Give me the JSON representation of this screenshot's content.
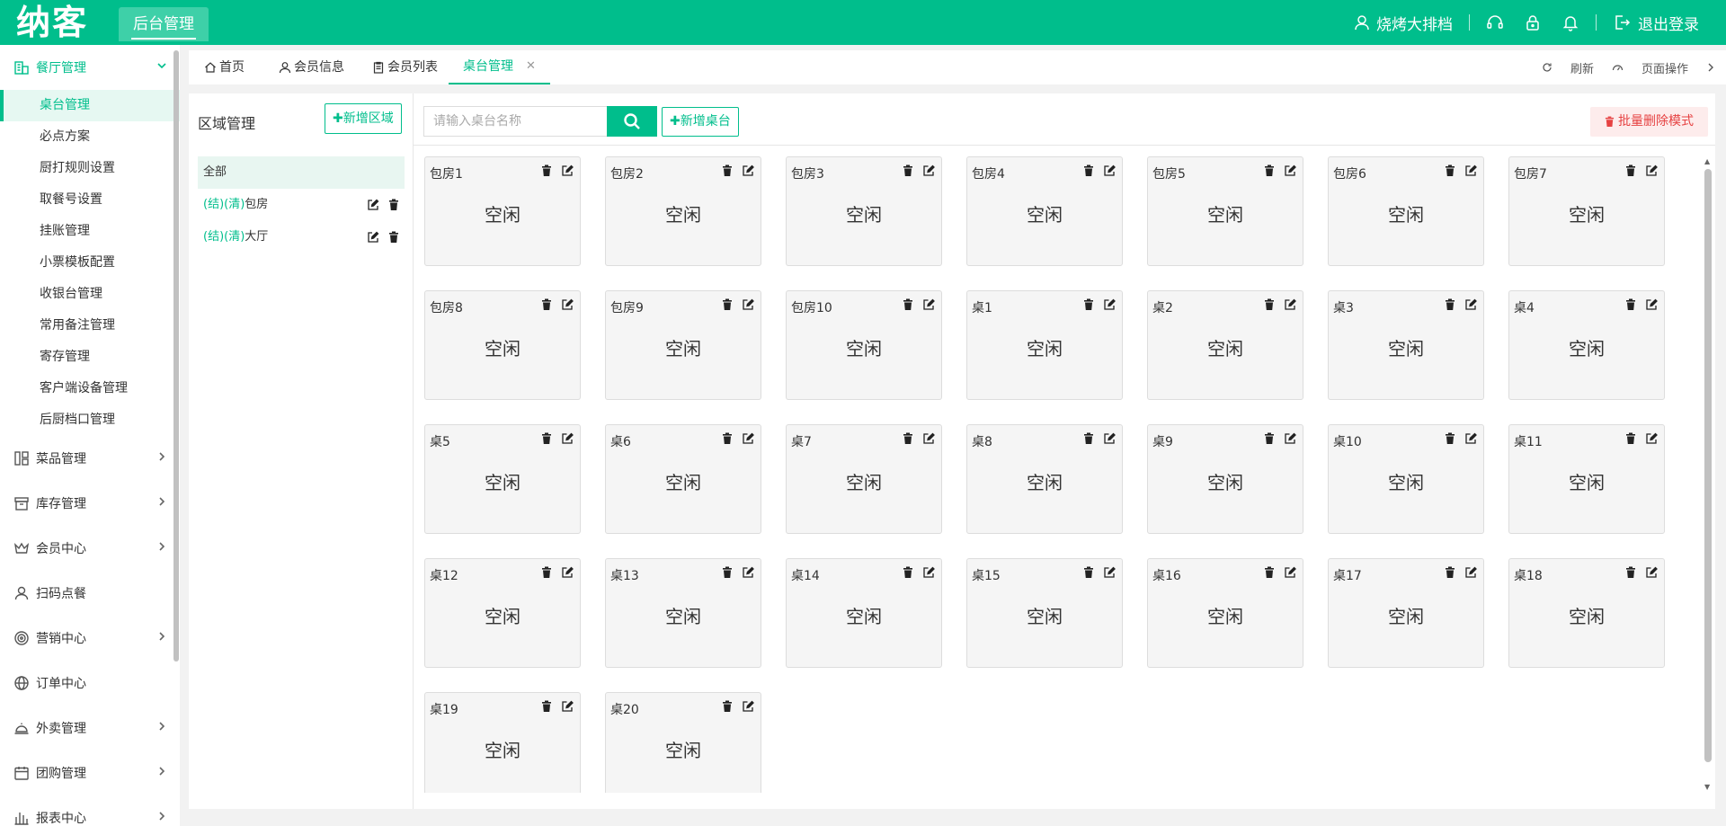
{
  "header": {
    "logo": "纳客",
    "module": "后台管理",
    "store": "烧烤大排档",
    "logout": "退出登录"
  },
  "sidebar": {
    "groups": [
      {
        "label": "餐厅管理",
        "icon": "building-icon"
      },
      {
        "label": "菜品管理",
        "icon": "dishes-icon"
      },
      {
        "label": "库存管理",
        "icon": "inventory-icon"
      },
      {
        "label": "会员中心",
        "icon": "crown-icon"
      },
      {
        "label": "扫码点餐",
        "icon": "user-icon"
      },
      {
        "label": "营销中心",
        "icon": "target-icon"
      },
      {
        "label": "订单中心",
        "icon": "globe-icon"
      },
      {
        "label": "外卖管理",
        "icon": "cloche-icon"
      },
      {
        "label": "团购管理",
        "icon": "calendar-icon"
      },
      {
        "label": "报表中心",
        "icon": "report-icon"
      }
    ],
    "items": [
      {
        "label": "桌台管理",
        "active": true
      },
      {
        "label": "必点方案"
      },
      {
        "label": "厨打规则设置"
      },
      {
        "label": "取餐号设置"
      },
      {
        "label": "挂账管理"
      },
      {
        "label": "小票模板配置"
      },
      {
        "label": "收银台管理"
      },
      {
        "label": "常用备注管理"
      },
      {
        "label": "寄存管理"
      },
      {
        "label": "客户端设备管理"
      },
      {
        "label": "后厨档口管理"
      }
    ]
  },
  "tabs": {
    "items": [
      {
        "label": "首页"
      },
      {
        "label": "会员信息"
      },
      {
        "label": "会员列表"
      },
      {
        "label": "桌台管理",
        "active": true
      }
    ],
    "close": "✕",
    "refresh": "刷新",
    "page_ops": "页面操作"
  },
  "region": {
    "title": "区域管理",
    "add_label": "✚新增区域",
    "all": "全部",
    "items": [
      {
        "tag": "(结)(清)",
        "name": "包房"
      },
      {
        "tag": "(结)(清)",
        "name": "大厅"
      }
    ]
  },
  "toolbar": {
    "search_placeholder": "请输入桌台名称",
    "add_table": "✚新增桌台",
    "batch_delete": "批量删除模式"
  },
  "tables": [
    {
      "name": "包房1",
      "status": "空闲"
    },
    {
      "name": "包房2",
      "status": "空闲"
    },
    {
      "name": "包房3",
      "status": "空闲"
    },
    {
      "name": "包房4",
      "status": "空闲"
    },
    {
      "name": "包房5",
      "status": "空闲"
    },
    {
      "name": "包房6",
      "status": "空闲"
    },
    {
      "name": "包房7",
      "status": "空闲"
    },
    {
      "name": "包房8",
      "status": "空闲"
    },
    {
      "name": "包房9",
      "status": "空闲"
    },
    {
      "name": "包房10",
      "status": "空闲"
    },
    {
      "name": "桌1",
      "status": "空闲"
    },
    {
      "name": "桌2",
      "status": "空闲"
    },
    {
      "name": "桌3",
      "status": "空闲"
    },
    {
      "name": "桌4",
      "status": "空闲"
    },
    {
      "name": "桌5",
      "status": "空闲"
    },
    {
      "name": "桌6",
      "status": "空闲"
    },
    {
      "name": "桌7",
      "status": "空闲"
    },
    {
      "name": "桌8",
      "status": "空闲"
    },
    {
      "name": "桌9",
      "status": "空闲"
    },
    {
      "name": "桌10",
      "status": "空闲"
    },
    {
      "name": "桌11",
      "status": "空闲"
    },
    {
      "name": "桌12",
      "status": "空闲"
    },
    {
      "name": "桌13",
      "status": "空闲"
    },
    {
      "name": "桌14",
      "status": "空闲"
    },
    {
      "name": "桌15",
      "status": "空闲"
    },
    {
      "name": "桌16",
      "status": "空闲"
    },
    {
      "name": "桌17",
      "status": "空闲"
    },
    {
      "name": "桌18",
      "status": "空闲"
    },
    {
      "name": "桌19",
      "status": "空闲"
    },
    {
      "name": "桌20",
      "status": "空闲"
    }
  ],
  "colors": {
    "brand": "#00be8c",
    "danger": "#e64242"
  }
}
